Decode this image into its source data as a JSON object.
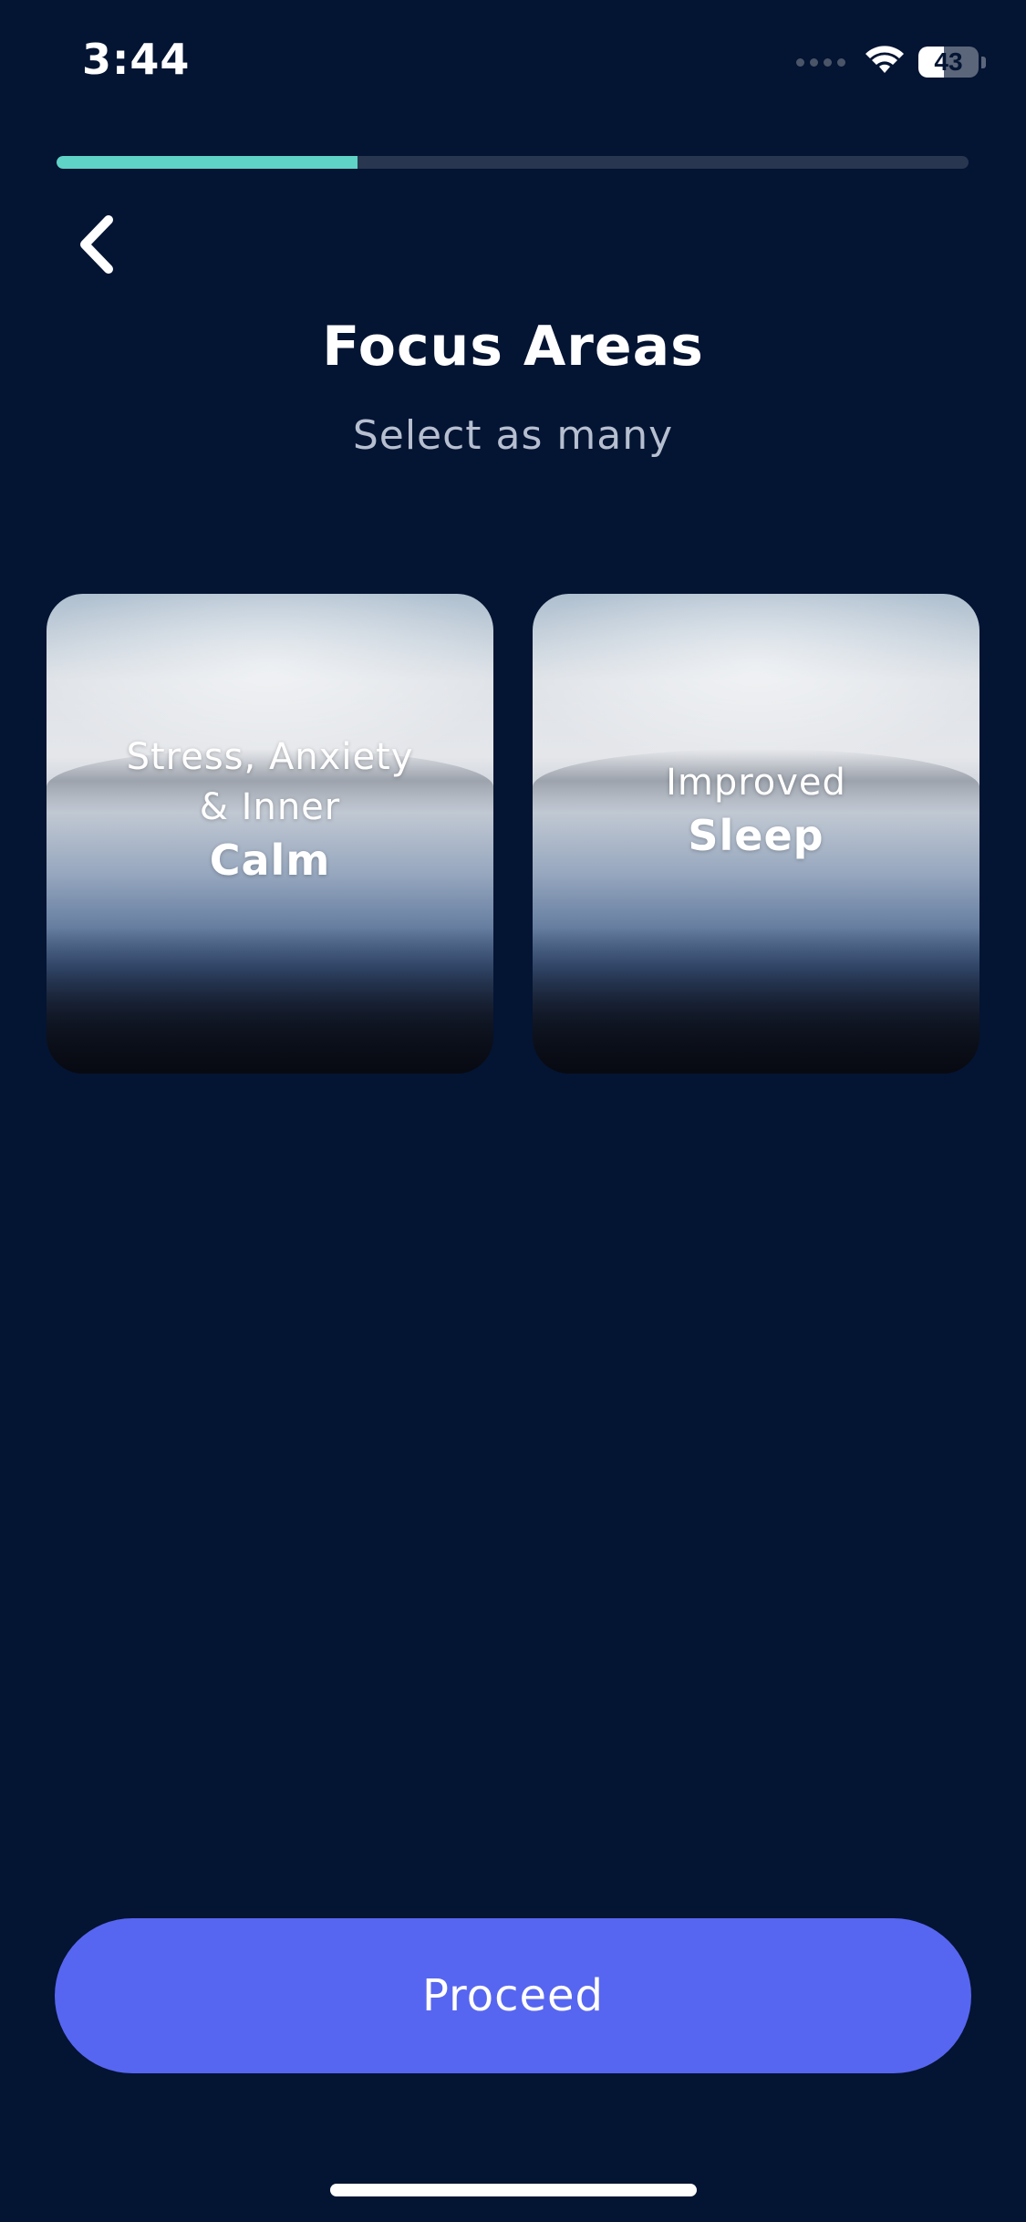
{
  "status_bar": {
    "time": "3:44",
    "battery_level": "43",
    "battery_fraction": 0.43,
    "icons": [
      "cellular-signal-icon",
      "wifi-icon",
      "battery-icon"
    ]
  },
  "onboarding_progress": {
    "fraction": 0.33,
    "fill_color": "#5fd3c6",
    "track_color": "#28364f"
  },
  "nav": {
    "back_icon": "chevron-left-icon"
  },
  "header": {
    "title": "Focus Areas",
    "subtitle": "Select as many"
  },
  "focus_cards": [
    {
      "line1": "Stress, Anxiety",
      "line2": "& Inner",
      "emphasis": "Calm"
    },
    {
      "line1": "Improved",
      "emphasis": "Sleep"
    }
  ],
  "actions": {
    "proceed_label": "Proceed"
  },
  "colors": {
    "background": "#041433",
    "accent": "#5766f0",
    "progress": "#5fd3c6"
  }
}
